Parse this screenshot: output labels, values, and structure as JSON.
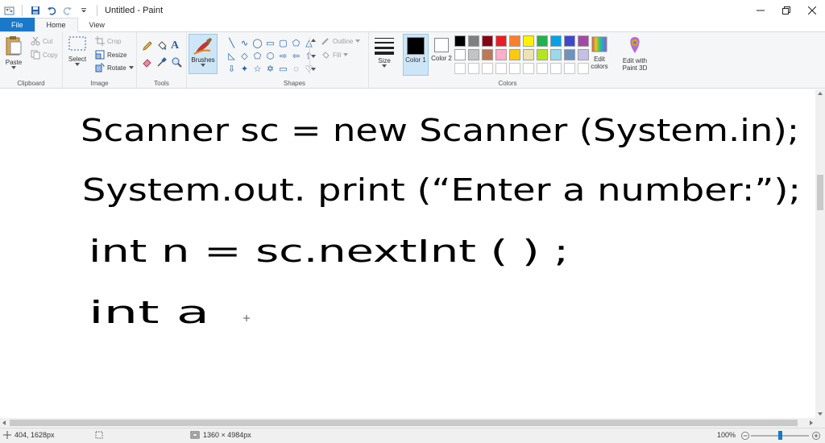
{
  "app": {
    "title": "Untitled - Paint"
  },
  "menu": {
    "file": "File",
    "home": "Home",
    "view": "View"
  },
  "clipboard": {
    "paste": "Paste",
    "cut": "Cut",
    "copy": "Copy",
    "label": "Clipboard"
  },
  "image": {
    "select": "Select",
    "crop": "Crop",
    "resize": "Resize",
    "rotate": "Rotate",
    "label": "Image"
  },
  "tools": {
    "label": "Tools"
  },
  "brushes": {
    "label": "Brushes"
  },
  "shapes": {
    "outline": "Outline",
    "fill": "Fill",
    "label": "Shapes"
  },
  "size": {
    "label": "Size"
  },
  "colors": {
    "color1": "Color 1",
    "color2": "Color 2",
    "edit_colors": "Edit colors",
    "edit_paint3d": "Edit with Paint 3D",
    "label": "Colors",
    "color1_value": "#000000",
    "color2_value": "#ffffff",
    "palette": [
      "#000000",
      "#7f7f7f",
      "#880015",
      "#ed1c24",
      "#ff7f27",
      "#fff200",
      "#22b14c",
      "#00a2e8",
      "#3f48cc",
      "#a349a4",
      "#ffffff",
      "#c3c3c3",
      "#b97a57",
      "#ffaec9",
      "#ffc90e",
      "#efe4b0",
      "#b5e61d",
      "#99d9ea",
      "#7092be",
      "#c8bfe7"
    ]
  },
  "canvas": {
    "handwriting": [
      "Scanner sc = new Scanner (System.in);",
      "System.out. print (“Enter a number:”);",
      "int n = sc.nextInt ( ) ;",
      "int a"
    ],
    "ink_color": "#000000"
  },
  "status": {
    "cursor_position": "404, 1628px",
    "canvas_size": "1360 × 4984px",
    "zoom": "100%"
  }
}
